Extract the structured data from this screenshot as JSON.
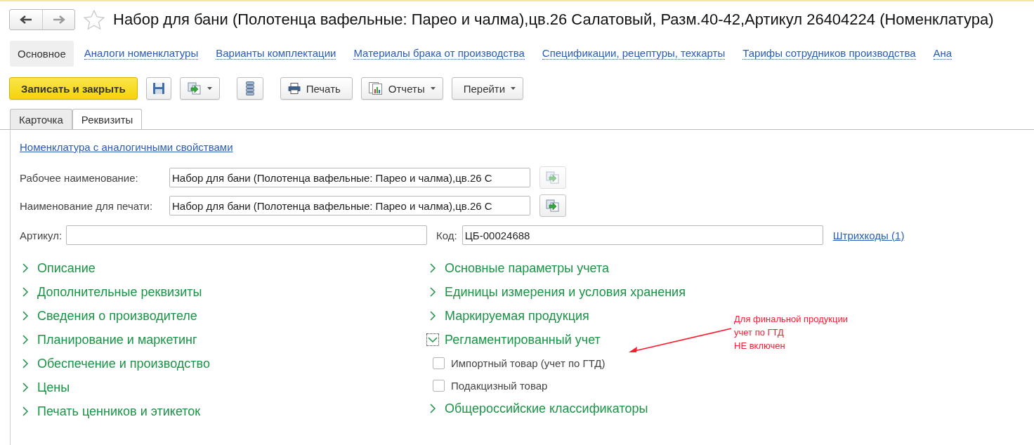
{
  "window": {
    "title": "Набор для бани (Полотенца вафельные: Парео и чалма),цв.26 Салатовый, Разм.40-42,Артикул 26404224 (Номенклатура)",
    "starred": false
  },
  "nav_links": [
    {
      "label": "Основное",
      "selected": true
    },
    {
      "label": "Аналоги номенклатуры",
      "selected": false
    },
    {
      "label": "Варианты комплектации",
      "selected": false
    },
    {
      "label": "Материалы брака от производства",
      "selected": false
    },
    {
      "label": "Спецификации, рецептуры, техкарты",
      "selected": false
    },
    {
      "label": "Тарифы сотрудников производства",
      "selected": false
    },
    {
      "label": "Ана",
      "selected": false
    }
  ],
  "toolbar": {
    "save_close": "Записать и закрыть",
    "print": "Печать",
    "reports": "Отчеты",
    "goto": "Перейти"
  },
  "tabs": [
    {
      "label": "Карточка",
      "selected": false
    },
    {
      "label": "Реквизиты",
      "selected": true
    }
  ],
  "similar_link": "Номенклатура с аналогичными свойствами",
  "working_name": {
    "label": "Рабочее наименование:",
    "value": "Набор для бани (Полотенца вафельные: Парео и чалма),цв.26 С",
    "disabled": true
  },
  "print_name": {
    "label": "Наименование для печати:",
    "value": "Набор для бани (Полотенца вафельные: Парео и чалма),цв.26 С",
    "disabled": false
  },
  "article": {
    "label": "Артикул:"
  },
  "code": {
    "label": "Код:",
    "value": "ЦБ-00024688"
  },
  "barcodes_link": "Штрихкоды (1)",
  "sections_left": [
    {
      "label": "Описание",
      "expanded": false
    },
    {
      "label": "Дополнительные реквизиты",
      "expanded": false
    },
    {
      "label": "Сведения о производителе",
      "expanded": false
    },
    {
      "label": "Планирование и маркетинг",
      "expanded": false
    },
    {
      "label": "Обеспечение и производство",
      "expanded": false
    },
    {
      "label": "Цены",
      "expanded": false
    },
    {
      "label": "Печать ценников и этикеток",
      "expanded": false
    }
  ],
  "sections_right": [
    {
      "label": "Основные параметры учета",
      "expanded": false
    },
    {
      "label": "Единицы измерения и условия хранения",
      "expanded": false
    },
    {
      "label": "Маркируемая продукция",
      "expanded": false
    },
    {
      "label": "Регламентированный учет",
      "expanded": true,
      "children": [
        {
          "label": "Импортный товар (учет по ГТД)",
          "checked": false
        },
        {
          "label": "Подакцизный товар",
          "checked": false
        }
      ]
    },
    {
      "label": "Общероссийские классификаторы",
      "expanded": false
    }
  ],
  "annotation": {
    "lines": [
      "Для финальной продукции",
      "учет по ГТД",
      "НЕ включен"
    ]
  }
}
